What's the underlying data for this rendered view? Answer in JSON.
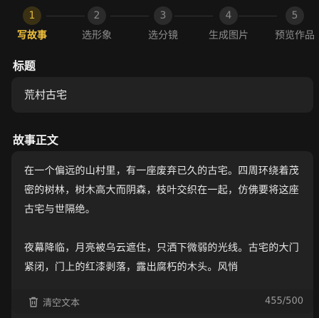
{
  "steps": [
    {
      "number": "1",
      "label": "写故事",
      "active": true
    },
    {
      "number": "2",
      "label": "选形象",
      "active": false
    },
    {
      "number": "3",
      "label": "选分镜",
      "active": false
    },
    {
      "number": "4",
      "label": "生成图片",
      "active": false
    },
    {
      "number": "5",
      "label": "预览作品",
      "active": false
    }
  ],
  "title_section": {
    "heading": "标题",
    "value": "荒村古宅"
  },
  "body_section": {
    "heading": "故事正文",
    "paragraphs": [
      "在一个偏远的山村里，有一座废弃已久的古宅。四周环绕着茂密的树林，树木高大而阴森，枝叶交织在一起，仿佛要将这座古宅与世隔绝。",
      "夜幕降临，月亮被乌云遮住，只洒下微弱的光线。古宅的大门紧闭，门上的红漆剥落，露出腐朽的木头。风悄"
    ],
    "clear_label": "清空文本",
    "char_count": "455/500"
  },
  "colors": {
    "accent": "#f0c03c",
    "background": "#141414",
    "card": "#222222"
  },
  "icons": {
    "clear": "trash-icon"
  }
}
